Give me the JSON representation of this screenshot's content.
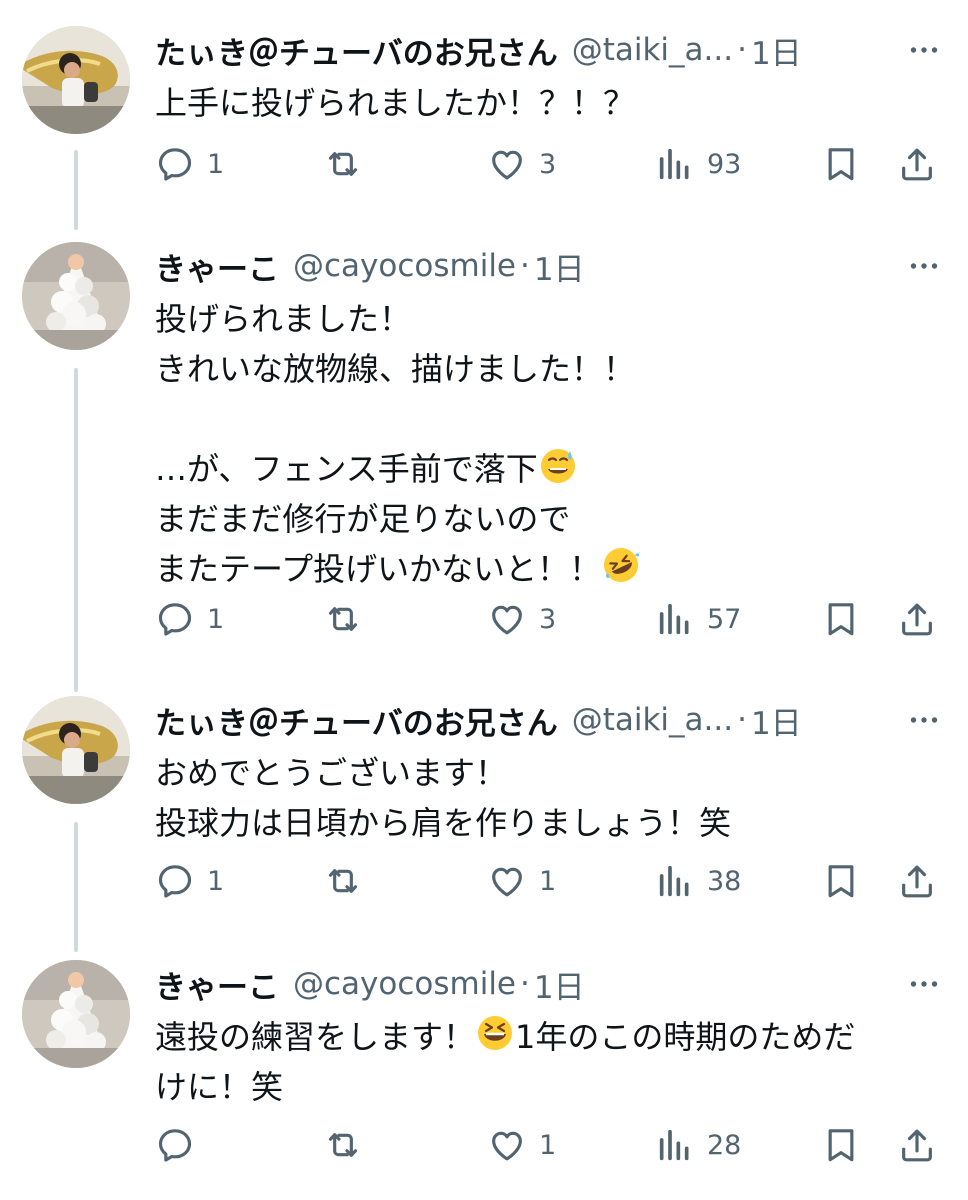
{
  "tweets": [
    {
      "name": "たぃき＠チューバのお兄さん",
      "handle": "@taiki_a...",
      "time": "1日",
      "text": "上手に投げられましたか！？！？",
      "replies": "1",
      "retweets": "",
      "likes": "3",
      "views": "93",
      "avatar": "tuba-player-avatar"
    },
    {
      "name": "きゃーこ",
      "handle": "@cayocosmile",
      "time": "1日",
      "text_lines": [
        "投げられました！",
        "きれいな放物線、描けました！！",
        "",
        "…が、フェンス手前で落下",
        "まだまだ修行が足りないので",
        "またテープ投げいかないと！！"
      ],
      "emoji_1": "sweat-smile-emoji",
      "emoji_2": "rofl-emoji",
      "replies": "1",
      "retweets": "",
      "likes": "3",
      "views": "57",
      "avatar": "white-flower-avatar"
    },
    {
      "name": "たぃき＠チューバのお兄さん",
      "handle": "@taiki_a...",
      "time": "1日",
      "text_lines": [
        "おめでとうございます！",
        "投球力は日頃から肩を作りましょう！笑"
      ],
      "replies": "1",
      "retweets": "",
      "likes": "1",
      "views": "38",
      "avatar": "tuba-player-avatar"
    },
    {
      "name": "きゃーこ",
      "handle": "@cayocosmile",
      "time": "1日",
      "text_part1": "遠投の練習をします！",
      "text_part2": "1年のこの時期のためだ",
      "text_line2": "けに！笑",
      "emoji": "grinning-squint-emoji",
      "replies": "",
      "retweets": "",
      "likes": "1",
      "views": "28",
      "avatar": "white-flower-avatar"
    }
  ],
  "colors": {
    "text": "#0f1419",
    "secondary": "#536471",
    "thread_line": "#cfd9de"
  }
}
